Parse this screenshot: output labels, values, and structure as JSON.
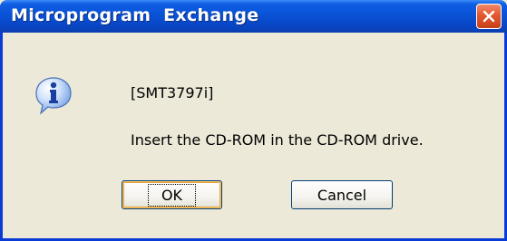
{
  "window": {
    "title": "Microprogram  Exchange"
  },
  "message": {
    "line1": "[SMT3797i]",
    "line2": "Insert the CD-ROM in the CD-ROM drive."
  },
  "buttons": {
    "ok_label": "OK",
    "cancel_label": "Cancel"
  },
  "icons": {
    "message_icon": "info-icon",
    "close_icon": "close-icon"
  },
  "colors": {
    "titlebar": "#0a54d8",
    "close_button": "#e4582f",
    "dialog_bg": "#ece9d8"
  }
}
